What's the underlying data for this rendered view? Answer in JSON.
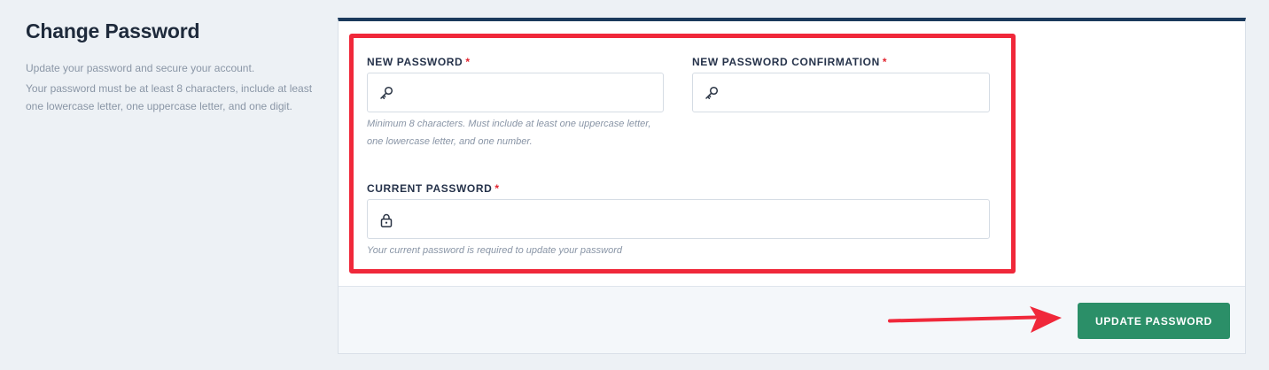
{
  "intro": {
    "title": "Change Password",
    "text1": "Update your password and secure your account.",
    "text2": "Your password must be at least 8 characters, include at least one lowercase letter, one uppercase letter, and one digit."
  },
  "form": {
    "new_password": {
      "label": "NEW PASSWORD",
      "required_mark": "*",
      "value": "",
      "icon": "key-icon",
      "help": "Minimum 8 characters. Must include at least one uppercase letter, one lowercase letter, and one number."
    },
    "confirm_password": {
      "label": "NEW PASSWORD CONFIRMATION",
      "required_mark": "*",
      "value": "",
      "icon": "key-icon"
    },
    "current_password": {
      "label": "CURRENT PASSWORD",
      "required_mark": "*",
      "value": "",
      "icon": "lock-icon",
      "help": "Your current password is required to update your password"
    }
  },
  "actions": {
    "update_label": "UPDATE PASSWORD"
  },
  "colors": {
    "accent_border": "#1b3a5c",
    "button": "#2b8f68",
    "annotation": "#f0283a",
    "required": "#e2242f"
  }
}
